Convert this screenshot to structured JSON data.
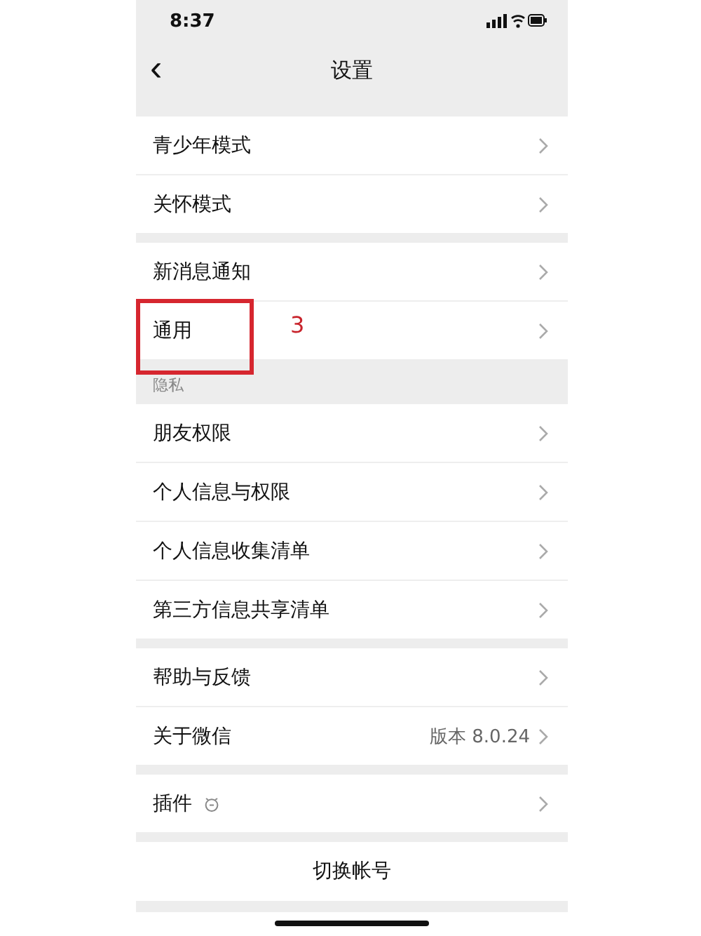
{
  "status_bar": {
    "time": "8:37"
  },
  "nav": {
    "back": "‹",
    "title": "设置"
  },
  "sections": [
    {
      "rows": [
        {
          "kind": "nav",
          "label": "青少年模式"
        },
        {
          "kind": "nav",
          "label": "关怀模式"
        }
      ]
    },
    {
      "rows": [
        {
          "kind": "nav",
          "label": "新消息通知"
        },
        {
          "kind": "nav",
          "label": "通用"
        }
      ]
    },
    {
      "header": "隐私",
      "rows": [
        {
          "kind": "nav",
          "label": "朋友权限"
        },
        {
          "kind": "nav",
          "label": "个人信息与权限"
        },
        {
          "kind": "nav",
          "label": "个人信息收集清单"
        },
        {
          "kind": "nav",
          "label": "第三方信息共享清单"
        }
      ]
    },
    {
      "rows": [
        {
          "kind": "nav",
          "label": "帮助与反馈"
        },
        {
          "kind": "nav",
          "label": "关于微信",
          "value": "版本 8.0.24"
        }
      ]
    },
    {
      "rows": [
        {
          "kind": "nav_icon",
          "label": "插件"
        }
      ]
    },
    {
      "rows": [
        {
          "kind": "action",
          "label": "切换帐号"
        }
      ]
    }
  ],
  "annotation": {
    "text": "3"
  }
}
